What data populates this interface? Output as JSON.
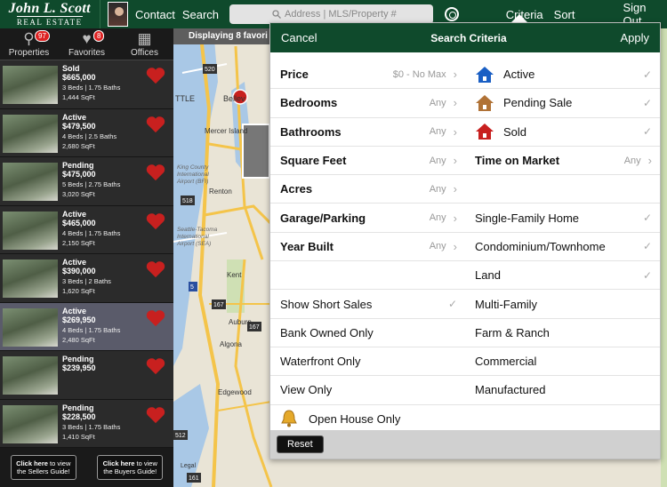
{
  "header": {
    "logo_line1": "John L. Scott",
    "logo_line2": "REAL ESTATE",
    "contact_label": "Contact",
    "search_label": "Search",
    "search_placeholder": "Address | MLS/Property #",
    "criteria_label": "Criteria",
    "sort_label": "Sort",
    "signout_label": "Sign Out"
  },
  "tabs": [
    {
      "label": "Properties",
      "badge": "97",
      "icon": "magnifier-icon"
    },
    {
      "label": "Favorites",
      "badge": "8",
      "icon": "heart-icon"
    },
    {
      "label": "Offices",
      "badge": "",
      "icon": "building-icon"
    }
  ],
  "displaying_text": "Displaying 8 favori",
  "listings": [
    {
      "status": "Sold",
      "price": "$665,000",
      "beds": "3 Beds | 1.75 Baths",
      "sqft": "1,444 SqFt"
    },
    {
      "status": "Active",
      "price": "$479,500",
      "beds": "4 Beds | 2.5 Baths",
      "sqft": "2,680 SqFt"
    },
    {
      "status": "Pending",
      "price": "$475,000",
      "beds": "5 Beds | 2.75 Baths",
      "sqft": "3,020 SqFt"
    },
    {
      "status": "Active",
      "price": "$465,000",
      "beds": "4 Beds | 1.75 Baths",
      "sqft": "2,150 SqFt"
    },
    {
      "status": "Active",
      "price": "$390,000",
      "beds": "3 Beds | 2 Baths",
      "sqft": "1,620 SqFt"
    },
    {
      "status": "Active",
      "price": "$269,950",
      "beds": "4 Beds | 1.75 Baths",
      "sqft": "2,480 SqFt"
    },
    {
      "status": "Pending",
      "price": "$239,950",
      "beds": "",
      "sqft": ""
    },
    {
      "status": "Pending",
      "price": "$228,500",
      "beds": "3 Beds | 1.75 Baths",
      "sqft": "1,410 SqFt"
    }
  ],
  "guides": {
    "sellers": {
      "bold": "Click here",
      "text": "to view the Sellers Guide!"
    },
    "buyers": {
      "bold": "Click here",
      "text": "to view the Buyers Guide!"
    }
  },
  "popover": {
    "cancel_label": "Cancel",
    "title": "Search Criteria",
    "apply_label": "Apply",
    "reset_label": "Reset",
    "left_rows": [
      {
        "label": "Price",
        "value": "$0 - No Max"
      },
      {
        "label": "Bedrooms",
        "value": "Any"
      },
      {
        "label": "Bathrooms",
        "value": "Any"
      },
      {
        "label": "Square Feet",
        "value": "Any"
      },
      {
        "label": "Acres",
        "value": "Any"
      },
      {
        "label": "Garage/Parking",
        "value": "Any"
      },
      {
        "label": "Year Built",
        "value": "Any"
      }
    ],
    "left_options": [
      {
        "label": "Show Short Sales",
        "checked": true
      },
      {
        "label": "Bank Owned Only",
        "checked": false
      },
      {
        "label": "Waterfront Only",
        "checked": false
      },
      {
        "label": "View Only",
        "checked": false
      },
      {
        "label": "Open House Only",
        "checked": false
      }
    ],
    "status_rows": [
      {
        "label": "Active",
        "color": "#1a5fc4",
        "checked": true
      },
      {
        "label": "Pending Sale",
        "color": "#b07236",
        "checked": true
      },
      {
        "label": "Sold",
        "color": "#c8201f",
        "checked": true
      }
    ],
    "time_on_market": {
      "label": "Time on Market",
      "value": "Any"
    },
    "property_types": [
      {
        "label": "Single-Family Home",
        "checked": true
      },
      {
        "label": "Condominium/Townhome",
        "checked": true
      },
      {
        "label": "Land",
        "checked": true
      },
      {
        "label": "Multi-Family",
        "checked": false
      },
      {
        "label": "Farm & Ranch",
        "checked": false
      },
      {
        "label": "Commercial",
        "checked": false
      },
      {
        "label": "Manufactured",
        "checked": false
      }
    ]
  },
  "map": {
    "labels": [
      "TTLE",
      "Bellev",
      "Mercer Island",
      "Renton",
      "Kent",
      "Auburn",
      "Algona",
      "Edgewood",
      "Legal"
    ],
    "route_shields": [
      "520",
      "518",
      "167",
      "5",
      "167",
      "512",
      "161"
    ],
    "airport_labels": [
      "King County",
      "International",
      "Airport (BFI)",
      "Seattle-Tacoma",
      "International",
      "Airport (SEA)"
    ],
    "colors": {
      "land": "#e9e4d6",
      "water": "#a9c8e6",
      "park": "#cfe0b4",
      "road": "#f4c44a"
    }
  }
}
